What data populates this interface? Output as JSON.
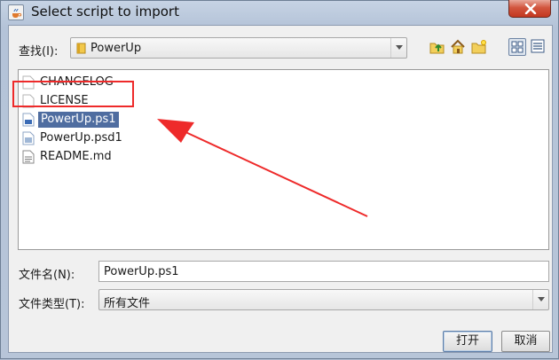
{
  "window": {
    "title": "Select script to import"
  },
  "look_in": {
    "label": "查找(I):",
    "value": "PowerUp"
  },
  "toolbar": {
    "icons": [
      "up-folder-icon",
      "home-icon",
      "new-folder-icon",
      "list-view-icon",
      "details-view-icon"
    ]
  },
  "files": [
    {
      "name": "CHANGELOG",
      "icon": "file-icon"
    },
    {
      "name": "LICENSE",
      "icon": "file-icon"
    },
    {
      "name": "PowerUp.ps1",
      "icon": "script-icon",
      "selected": true
    },
    {
      "name": "PowerUp.psd1",
      "icon": "data-file-icon"
    },
    {
      "name": "README.md",
      "icon": "text-file-icon"
    }
  ],
  "file_name": {
    "label": "文件名(N):",
    "value": "PowerUp.ps1"
  },
  "file_type": {
    "label": "文件类型(T):",
    "value": "所有文件"
  },
  "buttons": {
    "open": "打开",
    "cancel": "取消"
  },
  "colors": {
    "selection": "#4f6da0",
    "annotation": "#ee2a2a",
    "close": "#c3371f"
  }
}
